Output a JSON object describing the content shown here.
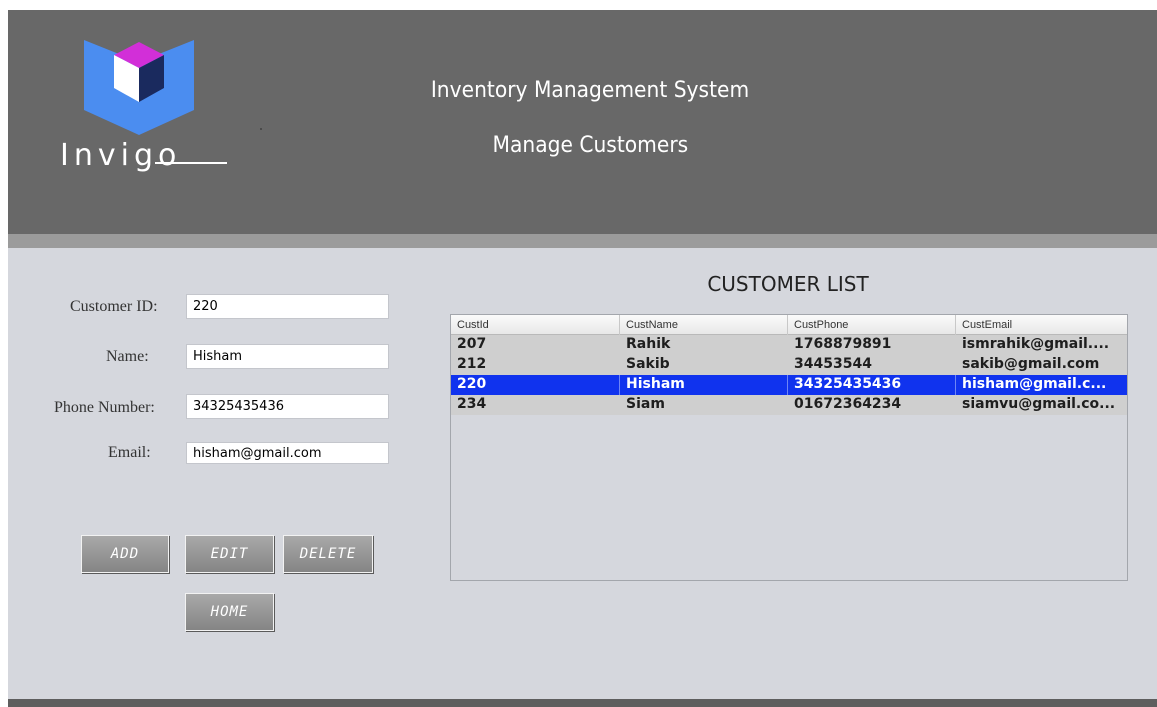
{
  "header": {
    "logo_text": "Invigo",
    "title": "Inventory Management System",
    "subtitle": "Manage Customers"
  },
  "form": {
    "customer_id": {
      "label": "Customer ID:",
      "value": "220"
    },
    "name": {
      "label": "Name:",
      "value": "Hisham"
    },
    "phone": {
      "label": "Phone Number:",
      "value": "34325435436"
    },
    "email": {
      "label": "Email:",
      "value": "hisham@gmail.com"
    }
  },
  "buttons": {
    "add": "ADD",
    "edit": "EDIT",
    "delete": "DELETE",
    "home": "HOME"
  },
  "customer_list": {
    "title": "CUSTOMER LIST",
    "columns": [
      "CustId",
      "CustName",
      "CustPhone",
      "CustEmail"
    ],
    "rows": [
      [
        "207",
        "Rahik",
        "1768879891",
        "ismrahik@gmail...."
      ],
      [
        "212",
        "Sakib",
        "34453544",
        "sakib@gmail.com"
      ],
      [
        "220",
        "Hisham",
        "34325435436",
        "hisham@gmail.c..."
      ],
      [
        "234",
        "Siam",
        "01672364234",
        "siamvu@gmail.co..."
      ]
    ],
    "selected_row": 2
  },
  "colors": {
    "header_bg": "#686868",
    "body_bg": "#d5d7dd",
    "selection": "#1033ee",
    "logo_blue": "#4b8df0",
    "logo_magenta": "#d22fd8",
    "logo_navy": "#1a2a5e"
  }
}
